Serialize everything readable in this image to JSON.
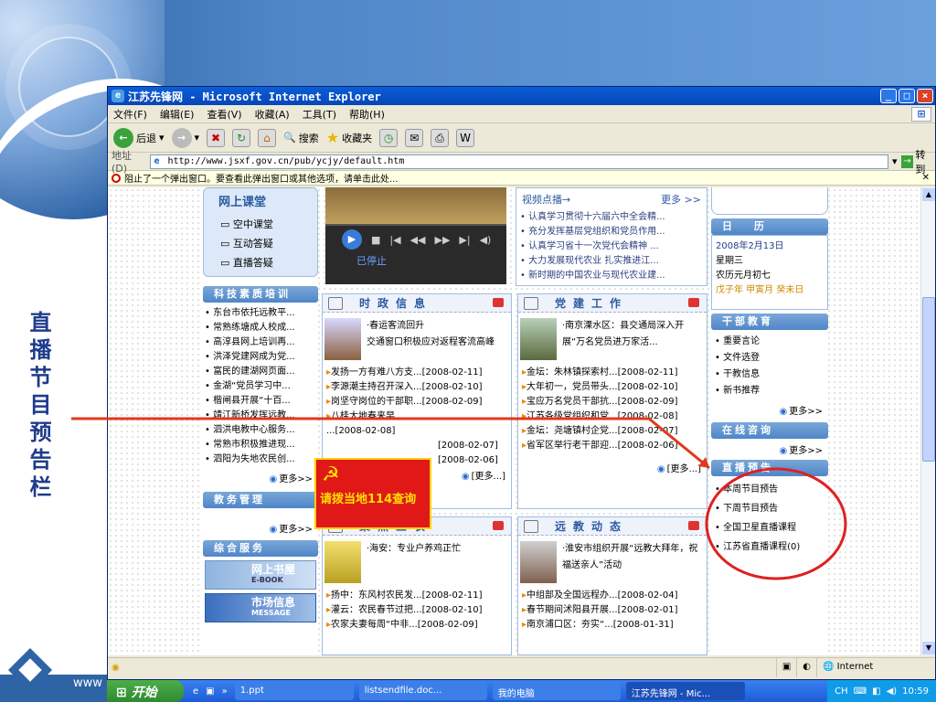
{
  "slide": {
    "vertical_label": "直播节目预告栏",
    "footer_text": "www",
    "colors": {
      "accent": "#2e64a6",
      "arrow": "#e0391c",
      "circle": "#e02020"
    }
  },
  "window": {
    "title": "江苏先锋网 - Microsoft Internet Explorer",
    "menu": [
      "文件(F)",
      "编辑(E)",
      "查看(V)",
      "收藏(A)",
      "工具(T)",
      "帮助(H)"
    ],
    "toolbar": {
      "back": "后退",
      "search": "搜索",
      "favorites": "收藏夹"
    },
    "address_label": "地址(D)",
    "address": "http://www.jsxf.gov.cn/pub/ycjy/default.htm",
    "go_label": "转到",
    "popup_notice": "阻止了一个弹出窗口。要查看此弹出窗口或其他选项，请单击此处...",
    "status_zone": "Internet"
  },
  "page": {
    "online_class": {
      "title": "网上课堂",
      "items": [
        "空中课堂",
        "互动答疑",
        "直播答疑"
      ]
    },
    "video": {
      "status": "已停止"
    },
    "video_points": {
      "title": "视频点播→",
      "more": "更多 >>",
      "items": [
        "认真学习贯彻十六届六中全会精...",
        "充分发挥基层党组织和党员作用...",
        "认真学习省十一次党代会精神 ...",
        "大力发展现代农业 扎实推进江...",
        "新时期的中国农业与现代农业建..."
      ]
    },
    "calendar": {
      "title": "日 历",
      "date": "2008年2月13日",
      "weekday": "星期三",
      "lunar": "农历元月初七",
      "ganzhi": "戊子年 甲寅月 癸未日"
    },
    "cadre_edu": {
      "title": "干部教育",
      "items": [
        "重要言论",
        "文件选登",
        "干教信息",
        "新书推荐"
      ],
      "more": "更多>>"
    },
    "online_consult": {
      "title": "在线咨询",
      "more": "更多>>"
    },
    "live_preview": {
      "title": "直播预告",
      "items": [
        "本周节目预告",
        "下周节目预告",
        "全国卫星直播课程",
        "江苏省直播课程(0)"
      ]
    },
    "tech_training": {
      "title": "科技素质培训",
      "items": [
        "东台市依托远教平...",
        "常熟练塘成人校成...",
        "高淳县网上培训再...",
        "洪泽党建网成为党...",
        "富民的建湖网页面...",
        "金湖“党员学习中...",
        "楷闸县开展“十百...",
        "靖江新桥发挥远教...",
        "泗洪电教中心服务...",
        "常熟市积极推进现...",
        "泗阳为失地农民创..."
      ],
      "more": "更多>>"
    },
    "edu_mgmt": {
      "title": "教务管理",
      "more": "更多>>"
    },
    "general_service": {
      "title": "综合服务",
      "banners": [
        "网上书屋",
        "E-BOOK",
        "市场信息",
        "MESSAGE"
      ]
    },
    "politics": {
      "title": "时政信息",
      "headline": "·春运客流回升\n交通窗口积极应对返程客流高峰",
      "items": [
        {
          "text": "发扬一方有难八方支...",
          "date": "[2008-02-11]"
        },
        {
          "text": "李源潮主持召开深入...",
          "date": "[2008-02-10]"
        },
        {
          "text": "岗坚守岗位的干部职...",
          "date": "[2008-02-09]"
        },
        {
          "text": "八桂大地春来早",
          "date": ""
        },
        {
          "text": "",
          "date": "...[2008-02-08]"
        },
        {
          "text": "",
          "date": "[2008-02-07]"
        },
        {
          "text": "",
          "date": "[2008-02-06]"
        }
      ],
      "more": "[更多...]"
    },
    "party_building": {
      "title": "党建工作",
      "headline": "·南京溧水区：县交通局深入开展“万名党员进万家活...",
      "items": [
        {
          "text": "金坛：朱林镇探索村...",
          "date": "[2008-02-11]"
        },
        {
          "text": "大年初一，党员带头...",
          "date": "[2008-02-10]"
        },
        {
          "text": "宝应万名党员干部抗...",
          "date": "[2008-02-09]"
        },
        {
          "text": "江苏各级党组织和党...",
          "date": "[2008-02-08]"
        },
        {
          "text": "金坛：尧塘镇村企党...",
          "date": "[2008-02-07]"
        },
        {
          "text": "省军区举行老干部迎...",
          "date": "[2008-02-06]"
        }
      ],
      "more": "[更多...]"
    },
    "focus_agri": {
      "title": "聚焦三农",
      "headline": "·海安：专业户养鸡正忙",
      "items": [
        {
          "text": "扬中：东风村农民发...",
          "date": "[2008-02-11]"
        },
        {
          "text": "灌云：农民春节过把...",
          "date": "[2008-02-10]"
        },
        {
          "text": "农家夫妻每周“中非...",
          "date": "[2008-02-09]"
        }
      ]
    },
    "remote_edu": {
      "title": "远教动态",
      "headline": "·淮安市组织开展“远教大拜年，祝福送亲人”活动",
      "items": [
        {
          "text": "中组部及全国远程办...",
          "date": "[2008-02-04]"
        },
        {
          "text": "春节期间沭阳县开展...",
          "date": "[2008-02-01]"
        },
        {
          "text": "南京浦口区：夯实“...",
          "date": "[2008-01-31]"
        }
      ]
    },
    "ad_banner": "请拨当地114查询"
  },
  "taskbar": {
    "start": "开始",
    "tasks": [
      "1.ppt",
      "listsendfile.doc...",
      "我的电脑",
      "江苏先锋网 - Mic..."
    ],
    "ime": "CH",
    "clock": "10:59"
  }
}
